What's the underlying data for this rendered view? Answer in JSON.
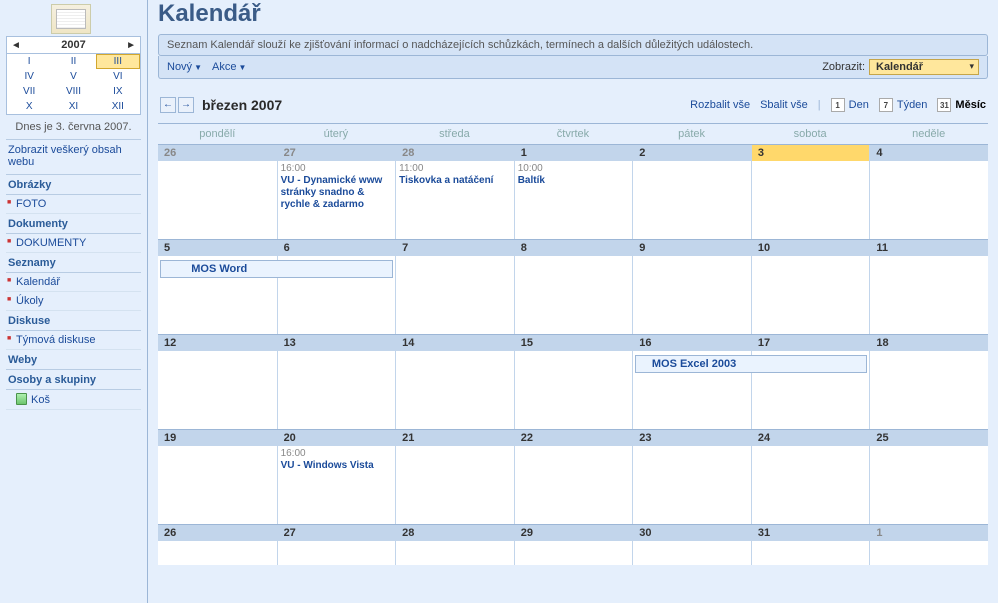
{
  "sidebar": {
    "year": "2007",
    "months": [
      "I",
      "II",
      "III",
      "IV",
      "V",
      "VI",
      "VII",
      "VIII",
      "IX",
      "X",
      "XI",
      "XII"
    ],
    "selected_month_index": 2,
    "today_text": "Dnes je 3. června 2007.",
    "show_all_link": "Zobrazit veškerý obsah webu",
    "sections": {
      "images": {
        "title": "Obrázky",
        "items": [
          "FOTO"
        ]
      },
      "documents": {
        "title": "Dokumenty",
        "items": [
          "DOKUMENTY"
        ]
      },
      "lists": {
        "title": "Seznamy",
        "items": [
          "Kalendář",
          "Úkoly"
        ]
      },
      "discussion": {
        "title": "Diskuse",
        "items": [
          "Týmová diskuse"
        ]
      },
      "sites": {
        "title": "Weby"
      },
      "people": {
        "title": "Osoby a skupiny"
      }
    },
    "recycle": "Koš"
  },
  "header": {
    "title": "Kalendář",
    "description": "Seznam Kalendář slouží ke zjišťování informací o nadcházejících schůzkách, termínech a dalších důležitých událostech."
  },
  "toolbar": {
    "new_label": "Nový",
    "actions_label": "Akce",
    "view_label": "Zobrazit:",
    "view_value": "Kalendář"
  },
  "calendar": {
    "month_title": "březen 2007",
    "expand": "Rozbalit vše",
    "collapse": "Sbalit vše",
    "day_label": "Den",
    "week_label": "Týden",
    "month_label": "Měsíc",
    "day_icon_num": "1",
    "week_icon_num": "7",
    "month_icon_num": "31",
    "dow": [
      "pondělí",
      "úterý",
      "středa",
      "čtvrtek",
      "pátek",
      "sobota",
      "neděle"
    ],
    "weeks": [
      {
        "days": [
          {
            "num": "26",
            "out": true
          },
          {
            "num": "27",
            "out": true,
            "events": [
              {
                "time": "16:00",
                "title": "VU - Dynamické www stránky snadno & rychle & zadarmo"
              }
            ]
          },
          {
            "num": "28",
            "out": true,
            "events": [
              {
                "time": "11:00",
                "title": "Tiskovka a natáčení"
              }
            ]
          },
          {
            "num": "1",
            "events": [
              {
                "time": "10:00",
                "title": "Baltík"
              }
            ]
          },
          {
            "num": "2"
          },
          {
            "num": "3",
            "today": true
          },
          {
            "num": "4"
          }
        ]
      },
      {
        "span": {
          "start": 0,
          "end": 1,
          "title": "MOS Word"
        },
        "days": [
          {
            "num": "5"
          },
          {
            "num": "6"
          },
          {
            "num": "7"
          },
          {
            "num": "8"
          },
          {
            "num": "9"
          },
          {
            "num": "10"
          },
          {
            "num": "11"
          }
        ]
      },
      {
        "span": {
          "start": 4,
          "end": 5,
          "title": "MOS Excel 2003"
        },
        "days": [
          {
            "num": "12"
          },
          {
            "num": "13"
          },
          {
            "num": "14"
          },
          {
            "num": "15"
          },
          {
            "num": "16"
          },
          {
            "num": "17"
          },
          {
            "num": "18"
          }
        ]
      },
      {
        "days": [
          {
            "num": "19"
          },
          {
            "num": "20",
            "events": [
              {
                "time": "16:00",
                "title": "VU - Windows Vista"
              }
            ]
          },
          {
            "num": "21"
          },
          {
            "num": "22"
          },
          {
            "num": "23"
          },
          {
            "num": "24"
          },
          {
            "num": "25"
          }
        ]
      },
      {
        "short": true,
        "days": [
          {
            "num": "26"
          },
          {
            "num": "27"
          },
          {
            "num": "28"
          },
          {
            "num": "29"
          },
          {
            "num": "30"
          },
          {
            "num": "31"
          },
          {
            "num": "1",
            "out": true
          }
        ]
      }
    ]
  }
}
